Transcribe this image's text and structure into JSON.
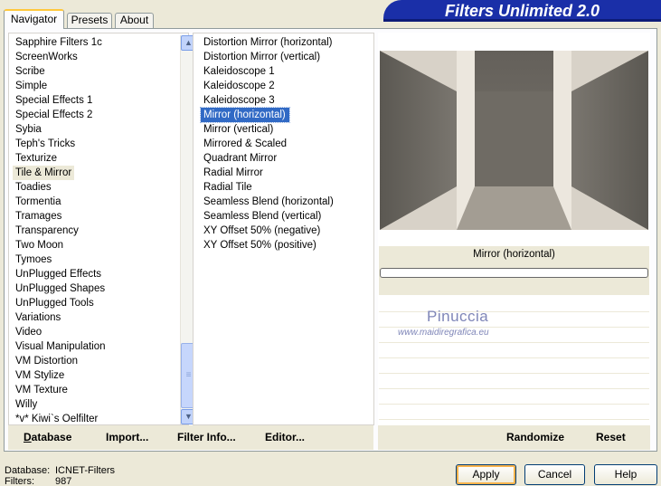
{
  "tabs": [
    {
      "label": "Navigator",
      "active": true
    },
    {
      "label": "Presets",
      "active": false
    },
    {
      "label": "About",
      "active": false
    }
  ],
  "title": "Filters Unlimited 2.0",
  "categories": [
    "Sapphire Filters 1c",
    "ScreenWorks",
    "Scribe",
    "Simple",
    "Special Effects 1",
    "Special Effects 2",
    "Sybia",
    "Teph's Tricks",
    "Texturize",
    "Tile & Mirror",
    "Toadies",
    "Tormentia",
    "Tramages",
    "Transparency",
    "Two Moon",
    "Tymoes",
    "UnPlugged Effects",
    "UnPlugged Shapes",
    "UnPlugged Tools",
    "Variations",
    "Video",
    "Visual Manipulation",
    "VM Distortion",
    "VM Stylize",
    "VM Texture",
    "Willy",
    "*v* Kiwi`s Oelfilter"
  ],
  "selected_category": "Tile & Mirror",
  "filters": [
    "Distortion Mirror (horizontal)",
    "Distortion Mirror (vertical)",
    "Kaleidoscope 1",
    "Kaleidoscope 2",
    "Kaleidoscope 3",
    "Mirror (horizontal)",
    "Mirror (vertical)",
    "Mirrored & Scaled",
    "Quadrant Mirror",
    "Radial Mirror",
    "Radial Tile",
    "Seamless Blend (horizontal)",
    "Seamless Blend (vertical)",
    "XY Offset 50% (negative)",
    "XY Offset 50% (positive)"
  ],
  "selected_filter": "Mirror (horizontal)",
  "current_filter_name": "Mirror (horizontal)",
  "watermark": {
    "name": "Pinuccia",
    "url": "www.maidiregrafica.eu"
  },
  "toolbar": {
    "database": "Database",
    "import": "Import...",
    "filter_info": "Filter Info...",
    "editor": "Editor...",
    "randomize": "Randomize",
    "reset": "Reset"
  },
  "status": {
    "database_label": "Database:",
    "database_value": "ICNET-Filters",
    "filters_label": "Filters:",
    "filters_value": "987"
  },
  "buttons": {
    "apply": "Apply",
    "cancel": "Cancel",
    "help": "Help"
  },
  "colors": {
    "banner": "#1a2fa8",
    "selection": "#316ac5"
  }
}
